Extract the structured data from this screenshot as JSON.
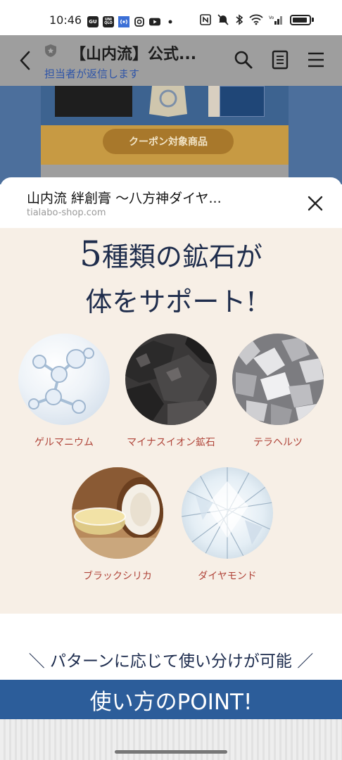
{
  "status_bar": {
    "time": "10:46",
    "icon_gu": "GU",
    "icon_uniqlo": "UNI QLO"
  },
  "chat": {
    "title": "【山内流】公式...",
    "subtitle": "担当者が返信します"
  },
  "background": {
    "coupon_button": "クーポン対象商品"
  },
  "modal": {
    "title": "山内流 絆創膏 〜八方神ダイヤ...",
    "url": "tialabo-shop.com"
  },
  "content": {
    "headline_num": "5",
    "headline_line1_rest": "種類の鉱石が",
    "headline_line2": "体をサポート!",
    "minerals": [
      {
        "label": "ゲルマニウム"
      },
      {
        "label": "マイナスイオン鉱石"
      },
      {
        "label": "テラヘルツ"
      },
      {
        "label": "ブラックシリカ"
      },
      {
        "label": "ダイヤモンド"
      }
    ],
    "pattern_text": "＼ パターンに応じて使い分けが可能 ／",
    "point_banner": "使い方のPOINT!"
  }
}
